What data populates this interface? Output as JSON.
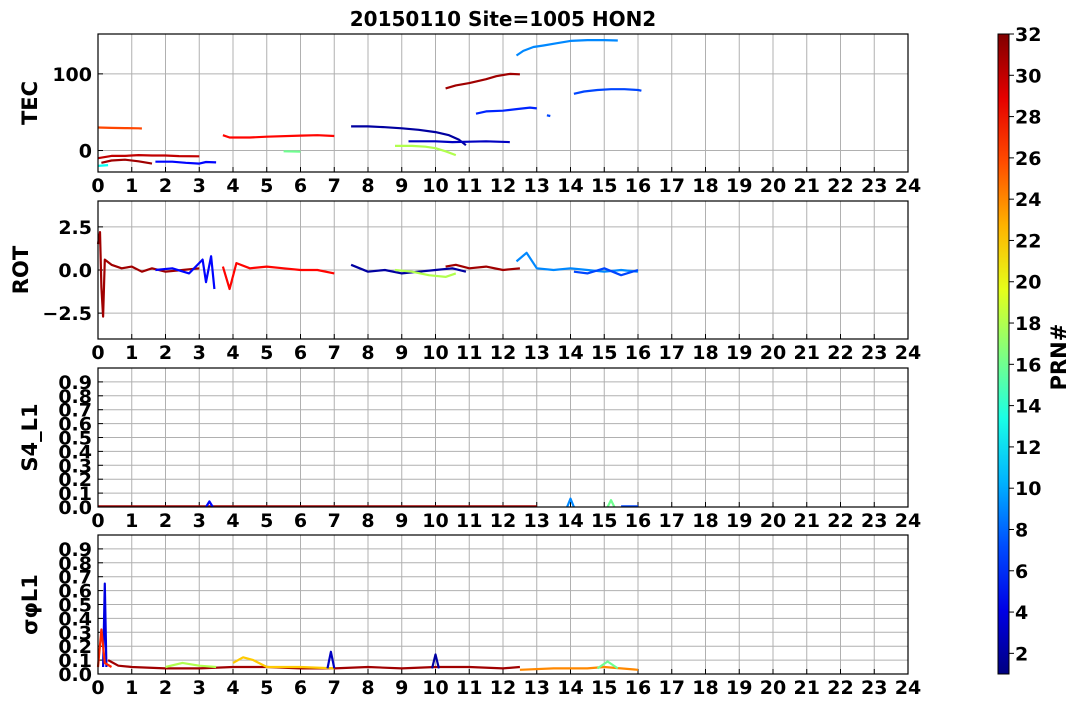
{
  "title": "20150110 Site=1005 HON2",
  "x_ticks": [
    "0",
    "1",
    "2",
    "3",
    "4",
    "5",
    "6",
    "7",
    "8",
    "9",
    "10",
    "11",
    "12",
    "13",
    "14",
    "15",
    "16",
    "17",
    "18",
    "19",
    "20",
    "21",
    "22",
    "23",
    "24"
  ],
  "colorbar": {
    "label": "PRN#",
    "range": [
      1,
      32
    ],
    "ticks": [
      "2",
      "4",
      "6",
      "8",
      "10",
      "12",
      "14",
      "16",
      "18",
      "20",
      "22",
      "24",
      "26",
      "28",
      "30",
      "32"
    ],
    "colormap": "jet"
  },
  "chart_data": [
    {
      "type": "line",
      "ylabel": "TEC",
      "xlim": [
        0,
        24
      ],
      "ylim": [
        -28,
        152
      ],
      "yticks": [
        "0",
        "100"
      ],
      "grid": true,
      "series": [
        {
          "prn": 26,
          "points": [
            [
              0,
              30
            ],
            [
              0.4,
              29.5
            ],
            [
              0.8,
              29.2
            ],
            [
              1.2,
              29
            ],
            [
              1.3,
              28.8
            ]
          ]
        },
        {
          "prn": 30,
          "points": [
            [
              0,
              -10
            ],
            [
              0.4,
              -7
            ],
            [
              0.8,
              -7
            ],
            [
              1.2,
              -6
            ],
            [
              1.6,
              -6.5
            ],
            [
              2,
              -6.5
            ],
            [
              2.4,
              -7.2
            ],
            [
              3,
              -7.5
            ]
          ]
        },
        {
          "prn": 31,
          "points": [
            [
              0.1,
              -16
            ],
            [
              0.4,
              -13
            ],
            [
              0.8,
              -12
            ],
            [
              1.2,
              -14
            ],
            [
              1.6,
              -17
            ]
          ]
        },
        {
          "prn": 5,
          "points": [
            [
              1.7,
              -14.5
            ],
            [
              2.2,
              -14.5
            ],
            [
              2.6,
              -16
            ],
            [
              3.0,
              -17
            ],
            [
              3.2,
              -15
            ],
            [
              3.5,
              -15.5
            ]
          ]
        },
        {
          "prn": 13,
          "points": [
            [
              0,
              -20
            ],
            [
              0.3,
              -19
            ]
          ]
        },
        {
          "prn": 28,
          "points": [
            [
              3.7,
              20
            ],
            [
              3.9,
              17
            ],
            [
              4.5,
              17
            ],
            [
              5,
              18
            ],
            [
              6,
              19.5
            ],
            [
              6.5,
              20
            ],
            [
              7,
              19
            ]
          ]
        },
        {
          "prn": 16,
          "points": [
            [
              5.5,
              -1
            ],
            [
              6,
              -1.5
            ]
          ]
        },
        {
          "prn": 2,
          "points": [
            [
              7.5,
              31.5
            ],
            [
              8,
              31.5
            ],
            [
              8.5,
              30.5
            ],
            [
              9,
              29
            ],
            [
              9.5,
              27
            ],
            [
              10,
              24
            ],
            [
              10.4,
              20
            ],
            [
              10.7,
              14
            ],
            [
              10.9,
              7
            ]
          ]
        },
        {
          "prn": 3,
          "points": [
            [
              9.2,
              12
            ],
            [
              10,
              12
            ],
            [
              10.5,
              11
            ],
            [
              11,
              11.5
            ],
            [
              11.5,
              12
            ],
            [
              12.2,
              11
            ]
          ]
        },
        {
          "prn": 18,
          "points": [
            [
              8.8,
              6
            ],
            [
              9.3,
              6
            ],
            [
              9.7,
              5
            ],
            [
              10,
              3
            ],
            [
              10.3,
              -1
            ],
            [
              10.6,
              -6
            ]
          ]
        },
        {
          "prn": 31,
          "points": [
            [
              10.3,
              81
            ],
            [
              10.6,
              85
            ],
            [
              11,
              88
            ],
            [
              11.5,
              93
            ],
            [
              11.8,
              97
            ],
            [
              12.2,
              100
            ],
            [
              12.5,
              99.5
            ]
          ]
        },
        {
          "prn": 6,
          "points": [
            [
              11.2,
              48
            ],
            [
              11.5,
              51
            ],
            [
              12,
              52
            ],
            [
              12.4,
              54
            ],
            [
              12.8,
              56
            ],
            [
              13,
              55
            ]
          ]
        },
        {
          "prn": 7,
          "points": [
            [
              13.3,
              46
            ],
            [
              13.4,
              45
            ]
          ]
        },
        {
          "prn": 9,
          "points": [
            [
              12.4,
              124
            ],
            [
              12.6,
              130
            ],
            [
              12.9,
              135
            ],
            [
              13.2,
              137
            ],
            [
              13.6,
              140
            ],
            [
              14,
              143
            ],
            [
              14.5,
              144
            ],
            [
              15,
              144
            ],
            [
              15.4,
              143.5
            ]
          ]
        },
        {
          "prn": 7,
          "points": [
            [
              14.1,
              74
            ],
            [
              14.4,
              77
            ],
            [
              14.8,
              79
            ],
            [
              15.2,
              80
            ],
            [
              15.6,
              80
            ],
            [
              16,
              79
            ],
            [
              16.1,
              78
            ]
          ]
        }
      ]
    },
    {
      "type": "line",
      "ylabel": "ROT",
      "xlim": [
        0,
        24
      ],
      "ylim": [
        -4,
        4
      ],
      "yticks": [
        "−2.5",
        "0.0",
        "2.5"
      ],
      "grid": true,
      "series": [
        {
          "prn": 31,
          "points": [
            [
              0,
              1.5
            ],
            [
              0.06,
              2.2
            ],
            [
              0.1,
              -1
            ],
            [
              0.15,
              -2.7
            ],
            [
              0.2,
              0.6
            ],
            [
              0.4,
              0.3
            ],
            [
              0.7,
              0.1
            ],
            [
              1,
              0.2
            ],
            [
              1.3,
              -0.1
            ],
            [
              1.6,
              0.1
            ],
            [
              2,
              -0.1
            ],
            [
              2.5,
              0
            ],
            [
              3,
              0.1
            ]
          ]
        },
        {
          "prn": 5,
          "points": [
            [
              1.7,
              0
            ],
            [
              2.2,
              0.1
            ],
            [
              2.7,
              -0.2
            ],
            [
              3.1,
              0.6
            ],
            [
              3.2,
              -0.7
            ],
            [
              3.35,
              0.8
            ],
            [
              3.45,
              -1.1
            ]
          ]
        },
        {
          "prn": 28,
          "points": [
            [
              3.7,
              0.2
            ],
            [
              3.9,
              -1.1
            ],
            [
              4.1,
              0.4
            ],
            [
              4.5,
              0.1
            ],
            [
              5,
              0.2
            ],
            [
              5.5,
              0.1
            ],
            [
              6,
              0
            ],
            [
              6.5,
              0
            ],
            [
              7,
              -0.2
            ]
          ]
        },
        {
          "prn": 2,
          "points": [
            [
              7.5,
              0.3
            ],
            [
              8,
              -0.1
            ],
            [
              8.5,
              0
            ],
            [
              9,
              -0.2
            ],
            [
              9.5,
              -0.1
            ],
            [
              10,
              0
            ],
            [
              10.5,
              0.1
            ],
            [
              10.9,
              -0.1
            ]
          ]
        },
        {
          "prn": 18,
          "points": [
            [
              8.8,
              0
            ],
            [
              9.3,
              -0.1
            ],
            [
              9.8,
              -0.3
            ],
            [
              10.3,
              -0.4
            ],
            [
              10.6,
              -0.2
            ]
          ]
        },
        {
          "prn": 31,
          "points": [
            [
              10.3,
              0.2
            ],
            [
              10.6,
              0.3
            ],
            [
              11,
              0.1
            ],
            [
              11.5,
              0.2
            ],
            [
              12,
              0
            ],
            [
              12.5,
              0.1
            ]
          ]
        },
        {
          "prn": 9,
          "points": [
            [
              12.4,
              0.5
            ],
            [
              12.7,
              1.0
            ],
            [
              13,
              0.1
            ],
            [
              13.5,
              0
            ],
            [
              14,
              0.1
            ],
            [
              14.5,
              0
            ],
            [
              15,
              -0.1
            ],
            [
              15.5,
              0
            ],
            [
              16,
              -0.1
            ]
          ]
        },
        {
          "prn": 7,
          "points": [
            [
              14.1,
              -0.1
            ],
            [
              14.5,
              -0.2
            ],
            [
              15,
              0.1
            ],
            [
              15.5,
              -0.3
            ],
            [
              16,
              0
            ]
          ]
        }
      ]
    },
    {
      "type": "line",
      "ylabel": "S4_L1",
      "xlim": [
        0,
        24
      ],
      "ylim": [
        0,
        1
      ],
      "yticks": [
        "0.0",
        "0.1",
        "0.2",
        "0.3",
        "0.4",
        "0.5",
        "0.6",
        "0.7",
        "0.8",
        "0.9"
      ],
      "grid": true,
      "series": [
        {
          "prn": 31,
          "points": [
            [
              0,
              0.005
            ],
            [
              4,
              0.005
            ],
            [
              8,
              0.005
            ],
            [
              12,
              0.005
            ],
            [
              13,
              0.005
            ]
          ]
        },
        {
          "prn": 5,
          "points": [
            [
              3.2,
              0
            ],
            [
              3.3,
              0.04
            ],
            [
              3.4,
              0
            ]
          ]
        },
        {
          "prn": 9,
          "points": [
            [
              13.9,
              0
            ],
            [
              14,
              0.06
            ],
            [
              14.1,
              0
            ]
          ]
        },
        {
          "prn": 16,
          "points": [
            [
              15.1,
              0
            ],
            [
              15.2,
              0.05
            ],
            [
              15.3,
              0
            ]
          ]
        },
        {
          "prn": 7,
          "points": [
            [
              15.5,
              0.005
            ],
            [
              16,
              0.005
            ]
          ]
        }
      ]
    },
    {
      "type": "line",
      "ylabel": "σφL1",
      "xlim": [
        0,
        24
      ],
      "ylim": [
        0,
        1
      ],
      "yticks": [
        "0.0",
        "0.1",
        "0.2",
        "0.3",
        "0.4",
        "0.5",
        "0.6",
        "0.7",
        "0.8",
        "0.9"
      ],
      "grid": true,
      "series": [
        {
          "prn": 4,
          "points": [
            [
              0.15,
              0.05
            ],
            [
              0.2,
              0.65
            ],
            [
              0.25,
              0.05
            ]
          ]
        },
        {
          "prn": 27,
          "points": [
            [
              0,
              0.05
            ],
            [
              0.1,
              0.32
            ],
            [
              0.2,
              0.08
            ],
            [
              0.4,
              0.05
            ]
          ]
        },
        {
          "prn": 31,
          "points": [
            [
              0.3,
              0.1
            ],
            [
              0.6,
              0.06
            ],
            [
              1,
              0.05
            ],
            [
              2,
              0.04
            ],
            [
              3,
              0.04
            ],
            [
              4,
              0.05
            ],
            [
              5,
              0.05
            ],
            [
              6,
              0.04
            ],
            [
              7,
              0.04
            ],
            [
              8,
              0.05
            ],
            [
              9,
              0.04
            ],
            [
              10,
              0.05
            ],
            [
              11,
              0.05
            ],
            [
              12,
              0.04
            ],
            [
              12.5,
              0.05
            ]
          ]
        },
        {
          "prn": 18,
          "points": [
            [
              2,
              0.05
            ],
            [
              2.5,
              0.08
            ],
            [
              3,
              0.06
            ],
            [
              3.5,
              0.05
            ]
          ]
        },
        {
          "prn": 22,
          "points": [
            [
              4,
              0.08
            ],
            [
              4.3,
              0.12
            ],
            [
              4.6,
              0.1
            ],
            [
              5,
              0.05
            ],
            [
              6,
              0.05
            ],
            [
              7,
              0.04
            ]
          ]
        },
        {
          "prn": 3,
          "points": [
            [
              6.8,
              0.04
            ],
            [
              6.9,
              0.16
            ],
            [
              7,
              0.04
            ]
          ]
        },
        {
          "prn": 2,
          "points": [
            [
              9.9,
              0.04
            ],
            [
              10,
              0.14
            ],
            [
              10.1,
              0.04
            ]
          ]
        },
        {
          "prn": 24,
          "points": [
            [
              12.5,
              0.03
            ],
            [
              13.5,
              0.04
            ],
            [
              14.5,
              0.04
            ],
            [
              15,
              0.05
            ],
            [
              16,
              0.03
            ]
          ]
        },
        {
          "prn": 16,
          "points": [
            [
              14.8,
              0.04
            ],
            [
              15.1,
              0.09
            ],
            [
              15.4,
              0.04
            ]
          ]
        }
      ]
    }
  ]
}
